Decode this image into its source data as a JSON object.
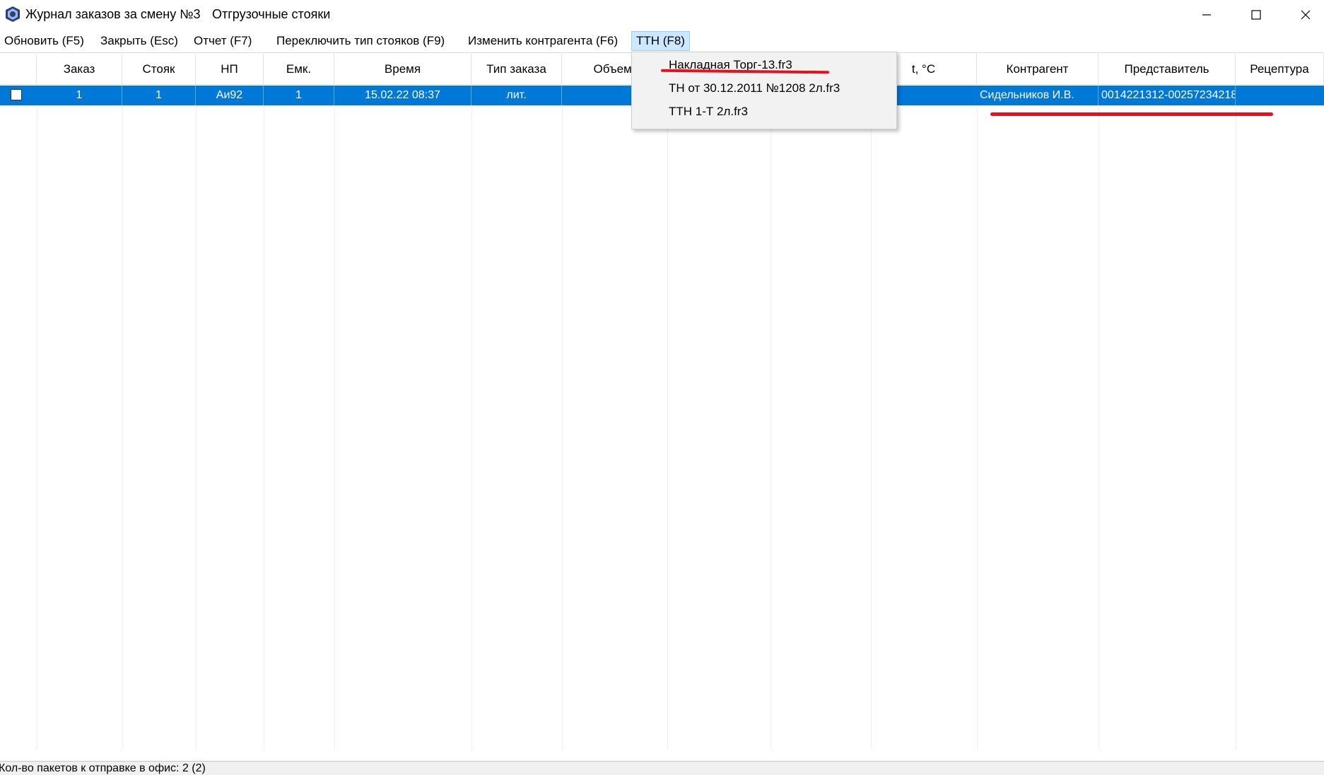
{
  "window": {
    "title": "Журнал заказов за смену №3",
    "subtitle": "Отгрузочные стояки",
    "controls": [
      "minimize",
      "maximize",
      "close"
    ]
  },
  "menubar": {
    "items": [
      {
        "label": "Обновить (F5)"
      },
      {
        "label": "Закрыть (Esc)"
      },
      {
        "label": "Отчет (F7)"
      },
      {
        "label": "Переключить тип стояков (F9)"
      },
      {
        "label": "Изменить контрагента (F6)"
      },
      {
        "label": "ТТН (F8)"
      }
    ]
  },
  "dropdown": {
    "items": [
      {
        "label": "Накладная Торг-13.fr3"
      },
      {
        "label": "ТН от 30.12.2011 №1208 2л.fr3"
      },
      {
        "label": "ТТН 1-Т 2л.fr3"
      }
    ]
  },
  "table": {
    "columns": [
      "",
      "Заказ",
      "Стояк",
      "НП",
      "Емк.",
      "Время",
      "Тип заказа",
      "Объем,",
      "",
      "",
      "t, °C",
      "Контрагент",
      "Представитель",
      "Рецептура"
    ],
    "rows": [
      {
        "checked": false,
        "order": "1",
        "stand": "1",
        "product": "Аи92",
        "tank": "1",
        "time": "15.02.22 08:37",
        "order_type": "лит.",
        "contractor": "Сидельников И.В.",
        "representative": "0014221312-00257234218"
      }
    ]
  },
  "status": {
    "text": "Кол-во пакетов к отправке в офис: 2 (2)"
  },
  "colors": {
    "selection": "#0078d7",
    "menu_active": "#cce8ff",
    "annotation_red": "#e8101b"
  }
}
